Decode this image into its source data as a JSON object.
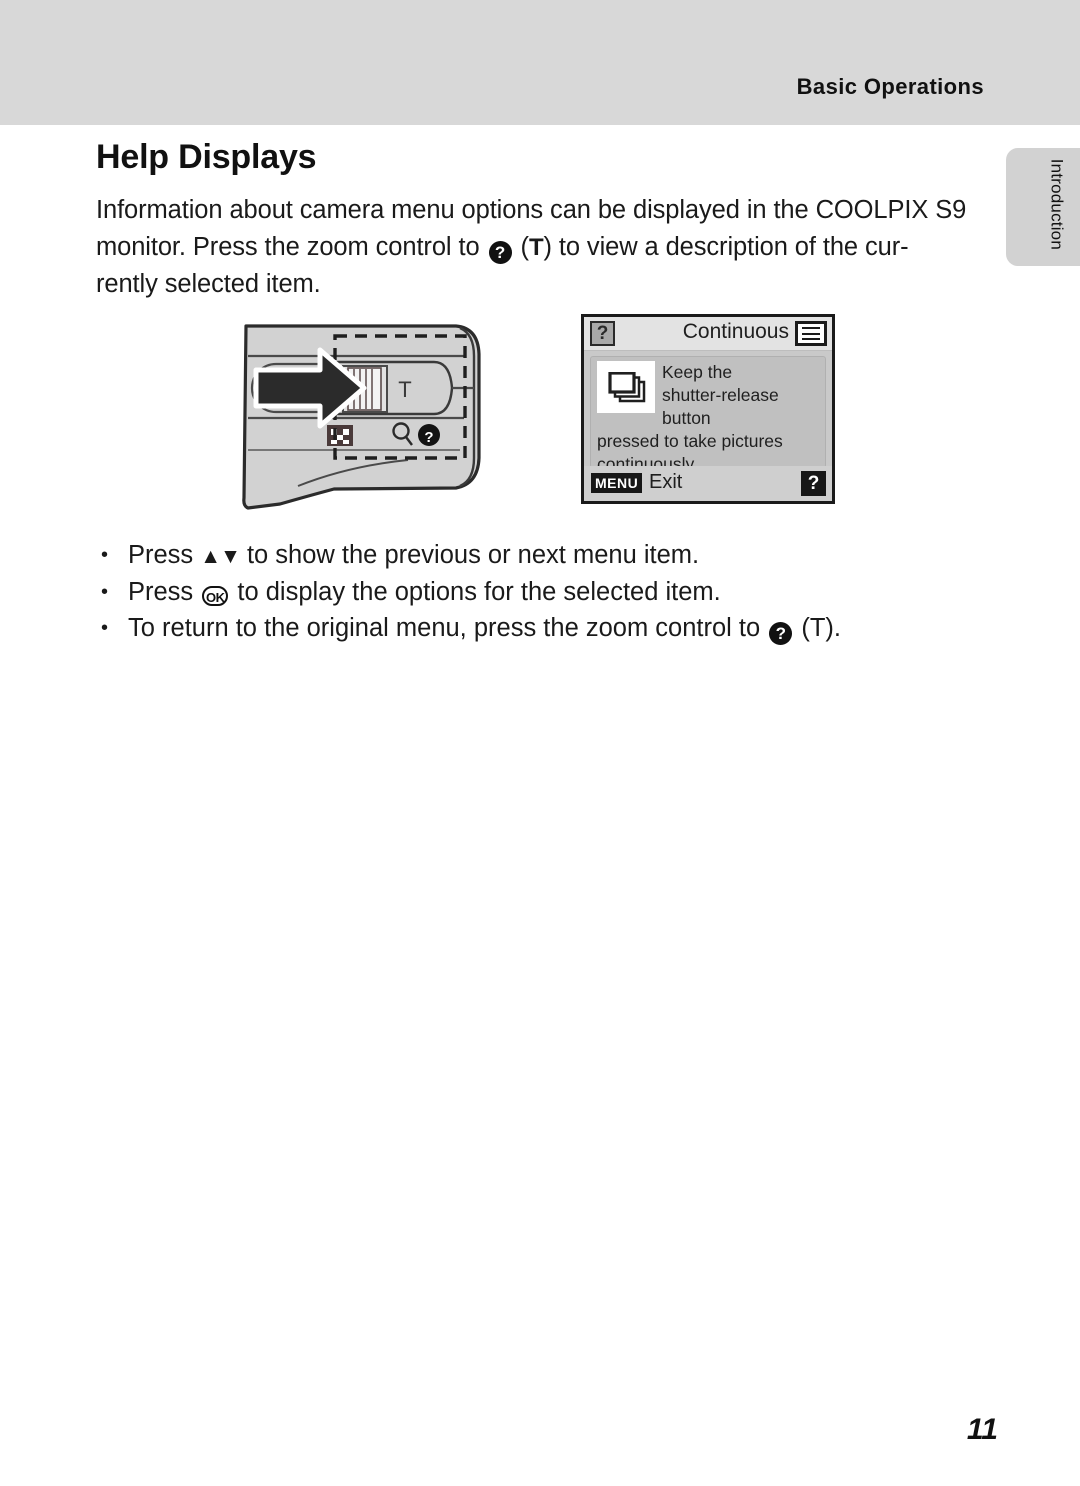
{
  "header": {
    "section_title": "Basic Operations"
  },
  "side_tab": {
    "label": "Introduction"
  },
  "page": {
    "heading": "Help Displays",
    "number": "11"
  },
  "intro": {
    "line1": "Information about camera menu options can be displayed in the COOLPIX S9",
    "line2_a": "monitor. Press the zoom control to",
    "line2_help_icon": "?",
    "line2_b": "(",
    "line2_t": "T",
    "line2_c": ") to view a description of the cur-",
    "line3": "rently selected item."
  },
  "camera_figure": {
    "zoom_t_label": "T",
    "thumbnail_icon": "thumbnail-grid-icon",
    "magnifier_icon": "magnifier-icon",
    "help_icon": "help-question-icon",
    "arrow_icon": "right-arrow-icon"
  },
  "lcd": {
    "help_badge": "?",
    "title": "Continuous",
    "mode_badge_icon": "shooting-menu-icon",
    "body_icon": "continuous-burst-icon",
    "body_text_line1": "Keep the",
    "body_text_line2": "shutter-release button",
    "body_text_line3": "pressed to take pictures",
    "body_text_line4": "continuously.",
    "menu_badge": "MENU",
    "exit_label": "Exit",
    "corner_help_badge": "?"
  },
  "bullets": [
    {
      "text_before": "Press",
      "glyph": "▲▼",
      "glyph_name": "up-down-arrows-glyph",
      "text_after": "to show the previous or next menu item."
    },
    {
      "text_before": "Press",
      "glyph": "OK",
      "glyph_name": "ok-button-glyph",
      "text_after": "to display the options for the selected item."
    },
    {
      "text_before": "To return to the original menu, press the zoom control to",
      "glyph": "?",
      "glyph_name": "help-question-glyph",
      "text_after": "(T)."
    }
  ],
  "colors": {
    "header_band": "#d8d8d8",
    "side_tab": "#d2d2d2",
    "lcd_screen": "#c9c9c9",
    "lcd_body": "#c0c0c0",
    "ink": "#1a1a1a"
  }
}
